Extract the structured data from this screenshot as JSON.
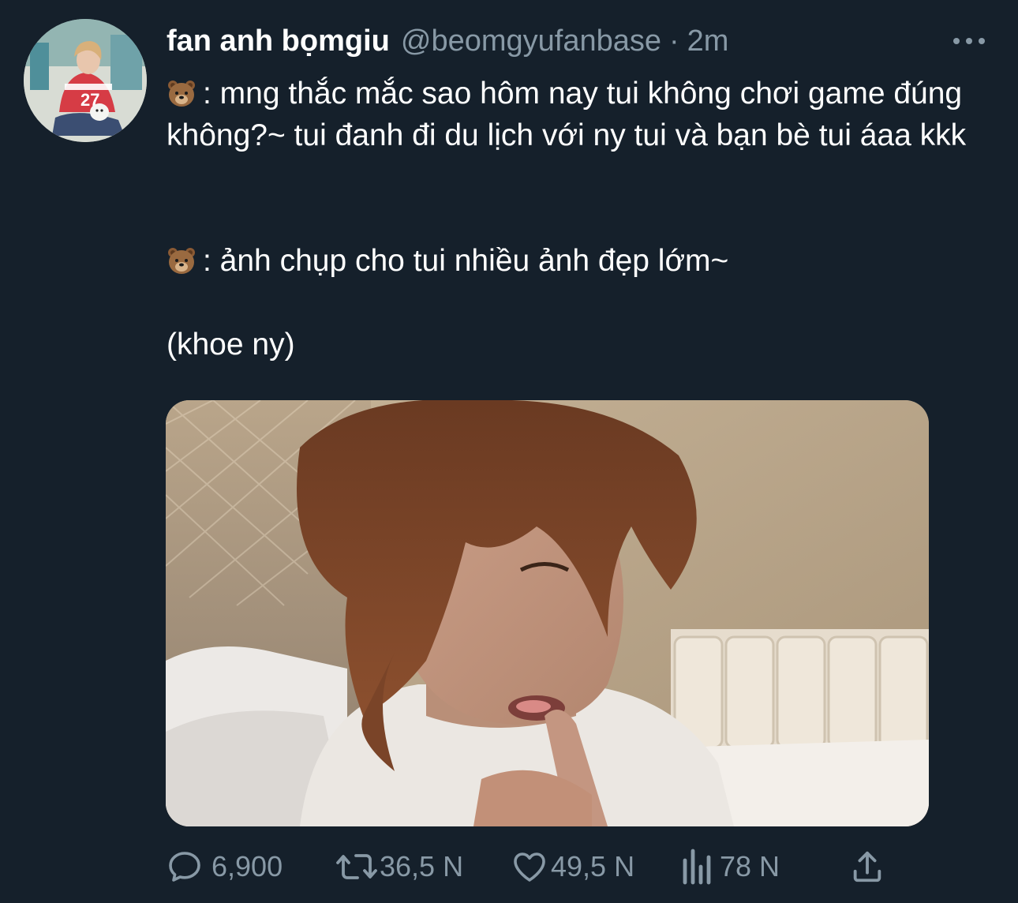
{
  "tweet": {
    "author_name": "fan anh bọmgiu",
    "handle": "@beomgyufanbase",
    "separator": "·",
    "time": "2m",
    "avatar_jersey_number": "27",
    "emoji": "🐻",
    "paragraphs": [
      ": mng thắc mắc sao hôm nay tui không chơi game đúng không?~ tui đanh đi du lịch với ny tui và bạn bè tui áaa kkk",
      ": ảnh chụp cho tui nhiều ảnh đẹp lớm~",
      "(khoe ny)"
    ]
  },
  "actions": {
    "reply_count": "6,900",
    "retweet_count": "36,5 N",
    "like_count": "49,5 N",
    "views_count": "78 N"
  },
  "colors": {
    "background": "#15202b",
    "text_primary": "#ffffff",
    "text_secondary": "#8899a6"
  },
  "icons": [
    "more-icon",
    "bear-emoji-icon",
    "reply-icon",
    "retweet-icon",
    "like-icon",
    "views-icon",
    "share-icon"
  ]
}
